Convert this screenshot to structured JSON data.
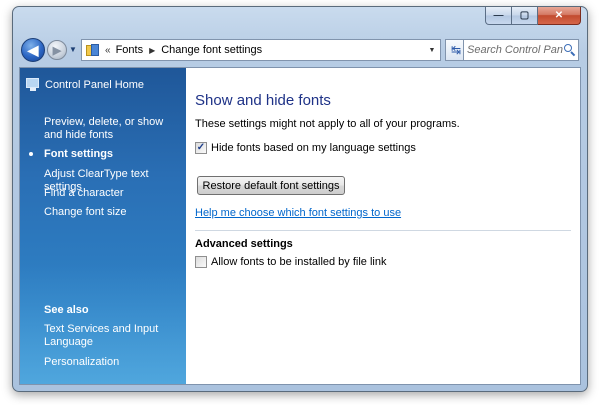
{
  "window": {
    "caption_buttons": {
      "minimize": "—",
      "maximize": "▢",
      "close": "✕"
    }
  },
  "nav": {
    "back_glyph": "◀",
    "forward_glyph": "▶",
    "recent_glyph": "▼",
    "breadcrumb_separator": "«",
    "breadcrumbs": [
      "Fonts",
      "Change font settings"
    ],
    "crumb_arrow": "▶",
    "address_dropdown": "▼",
    "refresh_glyph": "↹",
    "search_placeholder": "Search Control Panel"
  },
  "sidebar": {
    "home_label": "Control Panel Home",
    "items": [
      {
        "label": "Preview, delete, or show and hide fonts",
        "current": false
      },
      {
        "label": "Font settings",
        "current": true
      },
      {
        "label": "Adjust ClearType text settings",
        "current": false
      },
      {
        "label": "Find a character",
        "current": false
      },
      {
        "label": "Change font size",
        "current": false
      }
    ],
    "see_also_heading": "See also",
    "see_also": [
      {
        "label": "Text Services and Input Language"
      },
      {
        "label": "Personalization"
      }
    ]
  },
  "main": {
    "title": "Show and hide fonts",
    "note": "These settings might not apply to all of your programs.",
    "hide_fonts_checkbox": {
      "label": "Hide fonts based on my language settings",
      "checked": true,
      "check_glyph": "✓"
    },
    "restore_button": "Restore default font settings",
    "help_link": "Help me choose which font settings to use",
    "advanced_heading": "Advanced settings",
    "file_link_checkbox": {
      "label": "Allow fonts to be installed by file link",
      "checked": false,
      "check_glyph": ""
    }
  },
  "colors": {
    "title_blue": "#1e3287",
    "link_blue": "#0066cc",
    "sidebar_top": "#1f5799",
    "sidebar_bottom": "#3a94d3"
  }
}
